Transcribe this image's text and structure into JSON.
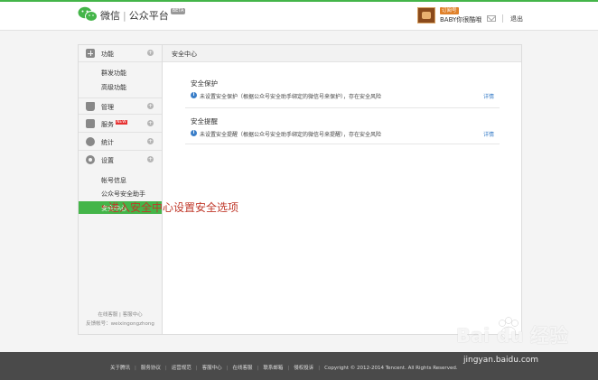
{
  "header": {
    "brand_main": "微信",
    "brand_sep": "|",
    "brand_sub": "公众平台",
    "brand_beta": "BETA",
    "account_type": "订阅号",
    "account_name": "BABY你很酷哦",
    "logout": "退出"
  },
  "sidebar": {
    "sections": [
      {
        "label": "功能",
        "icon": "grid-icon",
        "subs": [
          "群发功能",
          "高级功能"
        ]
      },
      {
        "label": "管理",
        "icon": "inbox-icon",
        "subs": []
      },
      {
        "label": "服务",
        "icon": "box-icon",
        "badge": "NEW",
        "subs": []
      },
      {
        "label": "统计",
        "icon": "pie-chart-icon",
        "subs": []
      },
      {
        "label": "设置",
        "icon": "gear-icon",
        "subs": [
          "帐号信息",
          "公众号安全助手",
          "安全中心"
        ]
      }
    ],
    "active_item": "安全中心",
    "footer_line1": "在线客服 | 客服中心",
    "footer_line2": "反馈帐号：weixingongzhong"
  },
  "main": {
    "panel_title": "安全中心",
    "sections": [
      {
        "title": "安全保护",
        "text": "未设置安全保护（根据公众号安全助手绑定的微信号来保护），存在安全风险",
        "link": "详情"
      },
      {
        "title": "安全提醒",
        "text": "未设置安全提醒（根据公众号安全助手绑定的微信号来提醒），存在安全风险",
        "link": "详情"
      }
    ],
    "annotation_arrow": "←",
    "annotation": "进入安全中心设置安全选项"
  },
  "footer": {
    "links": [
      "关于腾讯",
      "服务协议",
      "运营规范",
      "客服中心",
      "在线客服",
      "联系邮箱",
      "侵权投诉"
    ],
    "copyright": "Copyright © 2012-2014 Tencent. All Rights Reserved."
  },
  "watermark": {
    "main": "Bai du 经验",
    "sub": "jingyan.baidu.com"
  },
  "colors": {
    "accent_green": "#44b549",
    "link_blue": "#3a7ec8",
    "annotation_red": "#c0392b"
  }
}
